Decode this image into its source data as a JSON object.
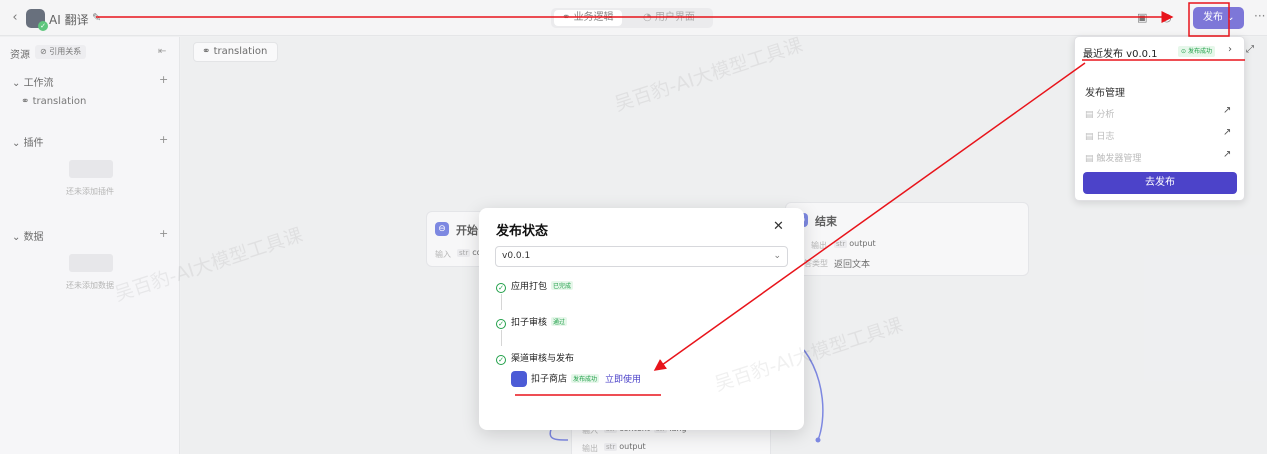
{
  "header": {
    "back": "‹",
    "app_title": "AI 翻译",
    "edit_icon": "✎",
    "tabs": [
      {
        "label": "业务逻辑"
      },
      {
        "label": "用户界面"
      }
    ],
    "publish_label": "发布",
    "publish_chevron": "⌄",
    "more": "···"
  },
  "sidebar": {
    "resources_label": "资源",
    "references_label": "引用关系",
    "sections": [
      {
        "label": "工作流",
        "items": [
          "translation"
        ]
      },
      {
        "label": "插件",
        "empty_text": "还未添加插件"
      },
      {
        "label": "数据",
        "empty_text": "还未添加数据"
      }
    ]
  },
  "canvas": {
    "tab_label": "translation",
    "start_node": {
      "title": "开始",
      "input_label": "输入",
      "var_type": "str",
      "var_name": "co"
    },
    "end_node": {
      "title": "结束",
      "output_label": "输出",
      "var_type": "str",
      "var_name": "output",
      "answer_label": "回答类型",
      "answer_value": "返回文本"
    },
    "bottom_node": {
      "input_label": "输入",
      "var1_type": "str",
      "var1_name": "content",
      "var2_type": "str",
      "var2_name": "lang",
      "output_label": "输出",
      "out_type": "str",
      "out_name": "output"
    }
  },
  "publish_panel": {
    "recent": "最近发布 v0.0.1",
    "recent_badge": "发布成功",
    "recent_chevron": "›",
    "section": "发布管理",
    "rows": [
      {
        "label": "分析"
      },
      {
        "label": "日志"
      },
      {
        "label": "触发器管理"
      }
    ],
    "arrow": "↗",
    "go_button": "去发布"
  },
  "modal": {
    "title": "发布状态",
    "close": "✕",
    "version": "v0.0.1",
    "steps": [
      {
        "label": "应用打包",
        "badge": "已完成"
      },
      {
        "label": "扣子审核",
        "badge": "通过"
      },
      {
        "label": "渠道审核与发布",
        "badge": ""
      }
    ],
    "store": {
      "name": "扣子商店",
      "badge": "发布成功",
      "link": "立即使用"
    }
  },
  "watermark": "吴百豹-AI大模型工具课",
  "colors": {
    "primary": "#4c43c9",
    "success": "#22a04a",
    "annotation": "#e8141b"
  }
}
